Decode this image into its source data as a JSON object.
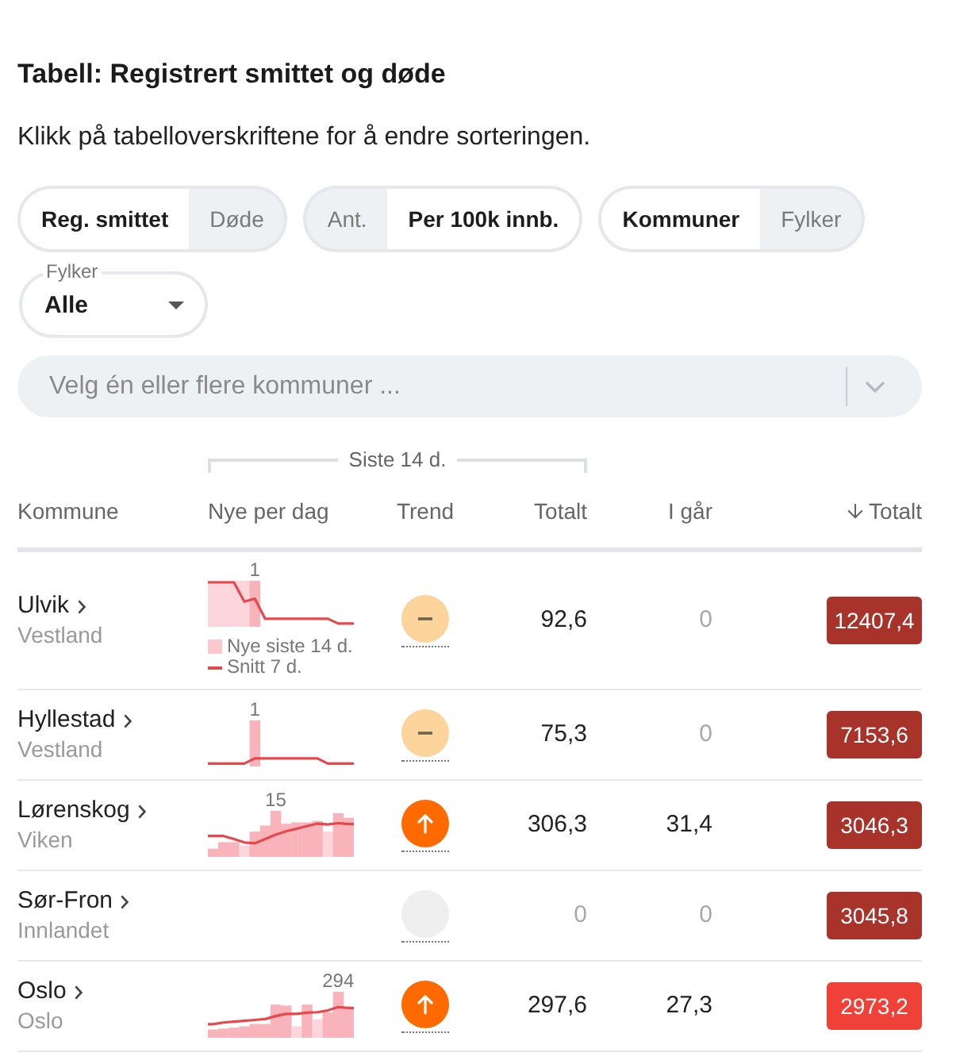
{
  "title": "Tabell: Registrert smittet og døde",
  "instruction": "Klikk på tabelloverskriftene for å endre sorteringen.",
  "toggles": [
    {
      "options": [
        {
          "label": "Reg. smittet",
          "selected": true
        },
        {
          "label": "Døde",
          "selected": false
        }
      ]
    },
    {
      "options": [
        {
          "label": "Ant.",
          "selected": false
        },
        {
          "label": "Per 100k innb.",
          "selected": true
        }
      ]
    },
    {
      "options": [
        {
          "label": "Kommuner",
          "selected": true
        },
        {
          "label": "Fylker",
          "selected": false
        }
      ]
    }
  ],
  "region_filter": {
    "label": "Fylker",
    "value": "Alle"
  },
  "municipality_search": {
    "placeholder": "Velg én eller flere kommuner ..."
  },
  "table": {
    "column_group": {
      "label": "Siste 14 d."
    },
    "columns": [
      {
        "label": "Kommune",
        "sorted": false
      },
      {
        "label": "Nye per dag",
        "sorted": false
      },
      {
        "label": "Trend",
        "sorted": false
      },
      {
        "label": "Totalt",
        "sorted": false
      },
      {
        "label": "I går",
        "sorted": false
      },
      {
        "label": "Totalt",
        "sorted": true
      }
    ],
    "rows": [
      {
        "name": "Ulvik",
        "region": "Vestland",
        "peak_label": "1",
        "legend": [
          {
            "kind": "bar",
            "label": "Nye siste 14 d."
          },
          {
            "kind": "line",
            "label": "Snitt 7 d."
          }
        ],
        "trend": {
          "kind": "flat"
        },
        "total": {
          "value": "92,6",
          "dimmed": false
        },
        "yesterday": {
          "value": "0",
          "dimmed": true
        },
        "cumulative": {
          "value": "12407,4",
          "color": "#a8332b"
        }
      },
      {
        "name": "Hyllestad",
        "region": "Vestland",
        "peak_label": "1",
        "trend": {
          "kind": "flat"
        },
        "total": {
          "value": "75,3",
          "dimmed": false
        },
        "yesterday": {
          "value": "0",
          "dimmed": true
        },
        "cumulative": {
          "value": "7153,6",
          "color": "#a8332b"
        }
      },
      {
        "name": "Lørenskog",
        "region": "Viken",
        "peak_label": "15",
        "trend": {
          "kind": "up"
        },
        "total": {
          "value": "306,3",
          "dimmed": false
        },
        "yesterday": {
          "value": "31,4",
          "dimmed": false
        },
        "cumulative": {
          "value": "3046,3",
          "color": "#a8332b"
        }
      },
      {
        "name": "Sør-Fron",
        "region": "Innlandet",
        "trend": {
          "kind": "none"
        },
        "total": {
          "value": "0",
          "dimmed": true
        },
        "yesterday": {
          "value": "0",
          "dimmed": true
        },
        "cumulative": {
          "value": "3045,8",
          "color": "#a8332b"
        }
      },
      {
        "name": "Oslo",
        "region": "Oslo",
        "peak_label": "294",
        "trend": {
          "kind": "up"
        },
        "total": {
          "value": "297,6",
          "dimmed": false
        },
        "yesterday": {
          "value": "27,3",
          "dimmed": false
        },
        "cumulative": {
          "value": "2973,2",
          "color": "#ef4137"
        }
      }
    ]
  }
}
